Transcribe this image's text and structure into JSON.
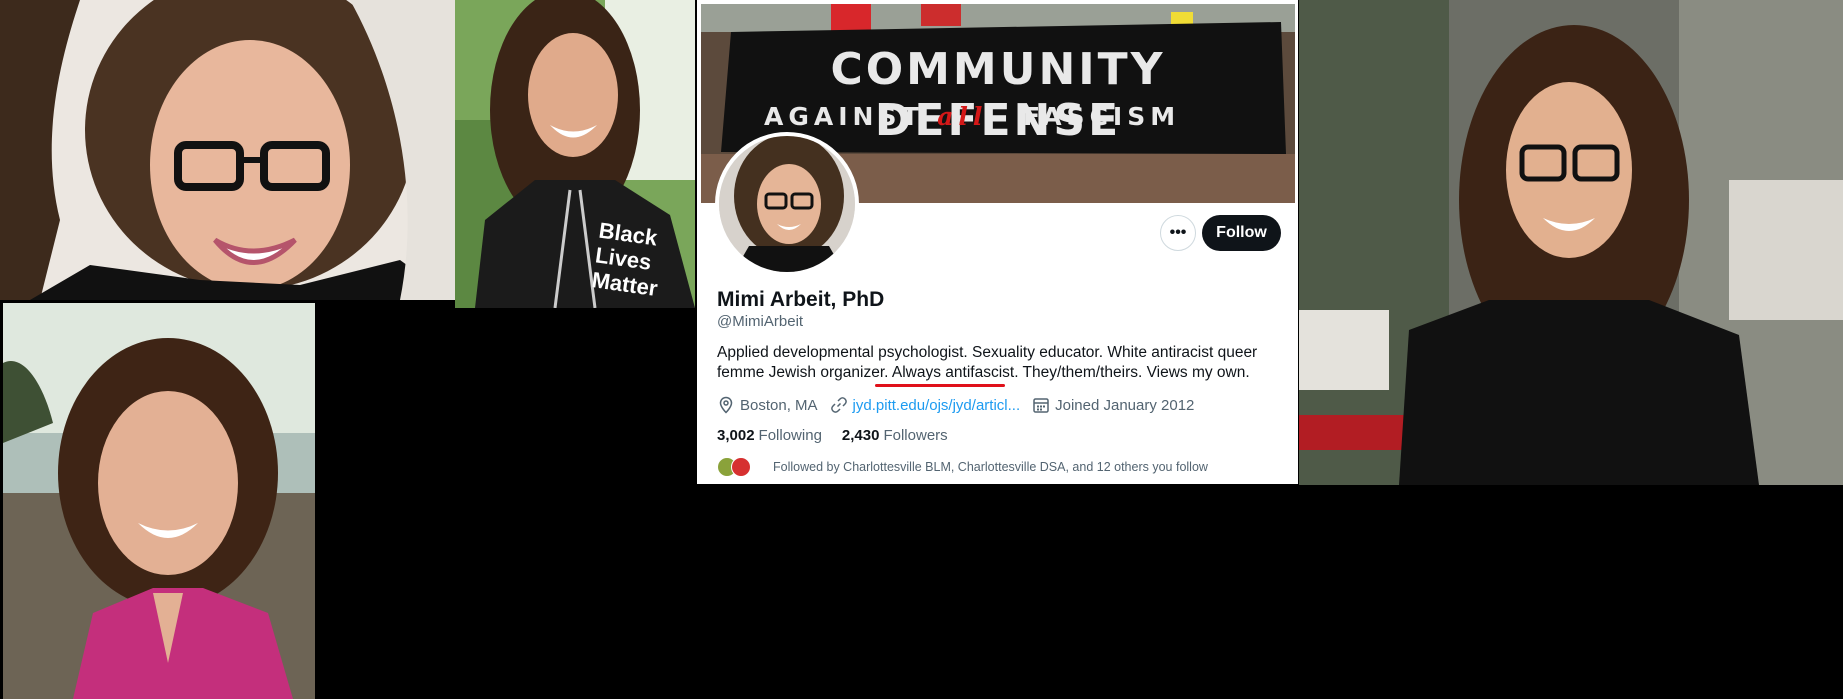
{
  "profile": {
    "banner_line1": "COMMUNITY DEFENSE",
    "banner_line2_a": "AGAINST",
    "banner_line2_all": "all",
    "banner_line2_b": "FASCISM",
    "name": "Mimi Arbeit, PhD",
    "handle": "@MimiArbeit",
    "bio_part1": "Applied developmental psychologist. Sexuality educator. White antiracist queer femme Jewish organizer. ",
    "bio_highlight": "Always antifascist",
    "bio_part2": ". They/them/theirs. Views my own.",
    "location": "Boston, MA",
    "website": "jyd.pitt.edu/ojs/jyd/articl...",
    "joined": "Joined January 2012",
    "following_count": "3,002",
    "following_label": "Following",
    "followers_count": "2,430",
    "followers_label": "Followers",
    "followed_by": "Followed by Charlottesville BLM, Charlottesville DSA, and 12 others you follow"
  },
  "buttons": {
    "more": "•••",
    "follow": "Follow"
  },
  "photos": {
    "shirt_text": "Black Lives Matter"
  },
  "colors": {
    "follow_bg": "#0f1419",
    "link": "#1d9bf0",
    "highlight_underline": "#e0101a"
  },
  "icons": [
    "location-icon",
    "link-icon",
    "calendar-icon"
  ]
}
